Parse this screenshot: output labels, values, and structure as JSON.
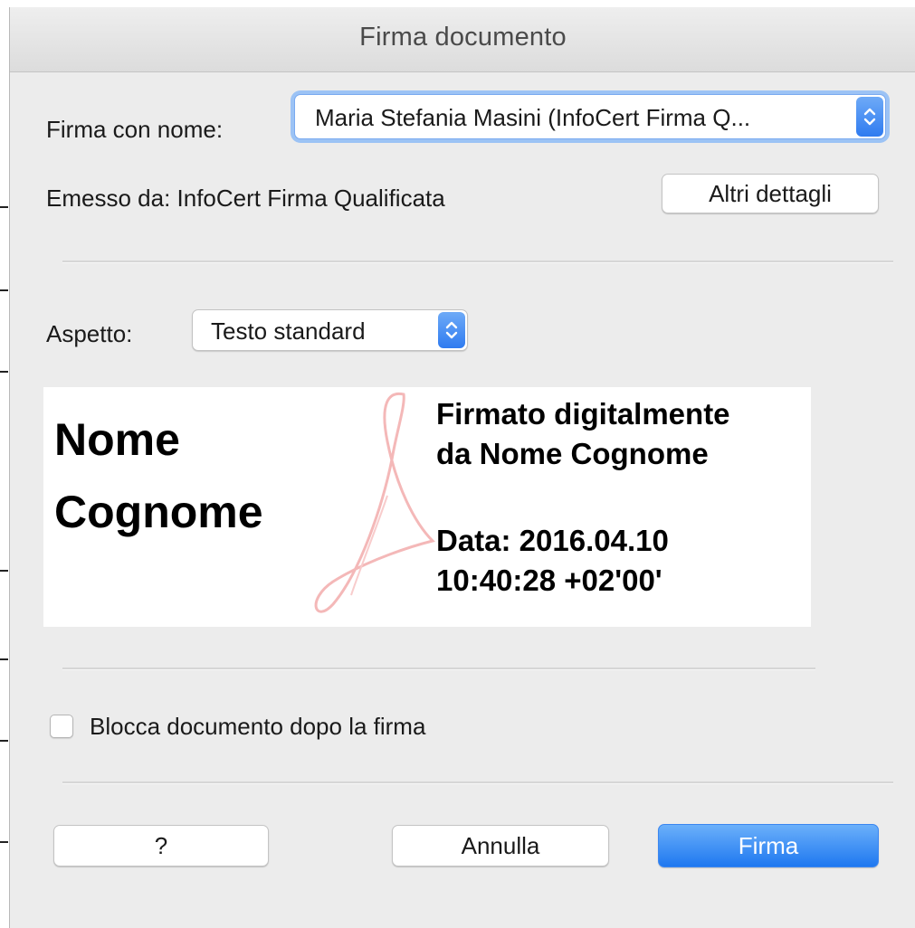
{
  "dialog": {
    "title": "Firma documento"
  },
  "signer": {
    "label": "Firma con nome:",
    "selected": "Maria Stefania Masini (InfoCert Firma Q..."
  },
  "issuer": {
    "label": "Emesso da: InfoCert Firma Qualificata",
    "details_button": "Altri dettagli"
  },
  "appearance": {
    "label": "Aspetto:",
    "selected": "Testo standard"
  },
  "preview": {
    "name_line1": "Nome",
    "name_line2": "Cognome",
    "signed_line1": "Firmato digitalmente",
    "signed_line2": "da Nome Cognome",
    "date_line1": "Data: 2016.04.10",
    "date_line2": "10:40:28 +02'00'"
  },
  "lock": {
    "label": "Blocca documento dopo la firma",
    "checked": false
  },
  "buttons": {
    "help": "?",
    "cancel": "Annulla",
    "sign": "Firma"
  },
  "colors": {
    "accent": "#2f7bf0",
    "watermark": "#f4b8b8"
  }
}
